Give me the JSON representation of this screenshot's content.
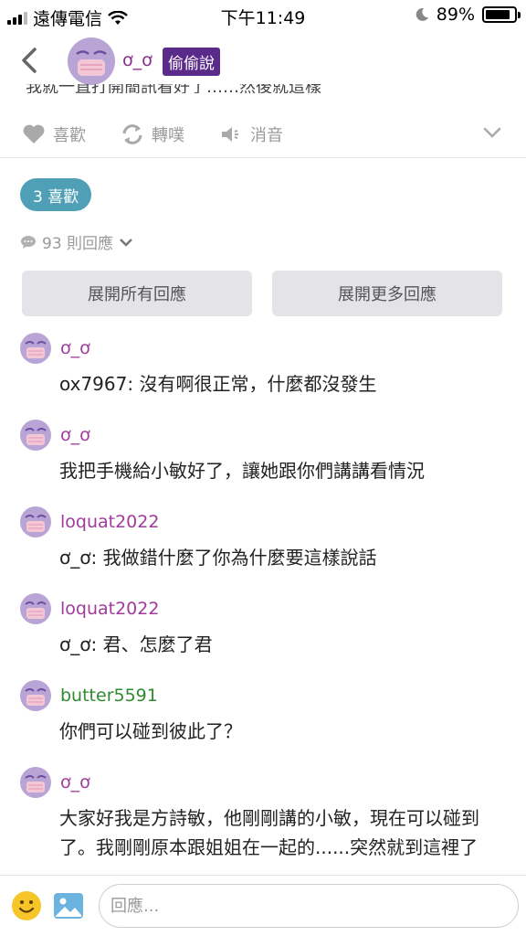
{
  "status_bar": {
    "carrier": "遠傳電信",
    "time": "下午11:49",
    "battery": "89%"
  },
  "header": {
    "name": "ơ_ơ",
    "badge": "偷偷說"
  },
  "post": {
    "cutoff_text": "我就一直打開簡訊看好了……然後就這樣"
  },
  "actions": {
    "like": "喜歡",
    "repost": "轉噗",
    "mute": "消音"
  },
  "likes": {
    "label": "3 喜歡"
  },
  "replies": {
    "count_label": "93 則回應"
  },
  "buttons": {
    "expand_all": "展開所有回應",
    "expand_more": "展開更多回應"
  },
  "comments": [
    {
      "user": "ơ_ơ",
      "text": "ox7967: 沒有啊很正常，什麼都沒發生"
    },
    {
      "user": "ơ_ơ",
      "text": "我把手機給小敏好了，讓她跟你們講講看情況"
    },
    {
      "user": "loquat2022",
      "text": "ơ_ơ: 我做錯什麼了你為什麼要這樣說話"
    },
    {
      "user": "loquat2022",
      "text": "ơ_ơ: 君、怎麼了君"
    },
    {
      "user": "butter5591",
      "text": "你們可以碰到彼此了？"
    },
    {
      "user": "ơ_ơ",
      "text": "大家好我是方詩敏，他剛剛講的小敏，現在可以碰到了。我剛剛原本跟姐姐在一起的......突然就到這裡了"
    }
  ],
  "reply_bar": {
    "placeholder": "回應..."
  },
  "colors": {
    "badge": "#5b2b8c",
    "pill": "#4fa0b7",
    "user_purple": "#a03a9c",
    "user_green": "#2e8b2e"
  }
}
